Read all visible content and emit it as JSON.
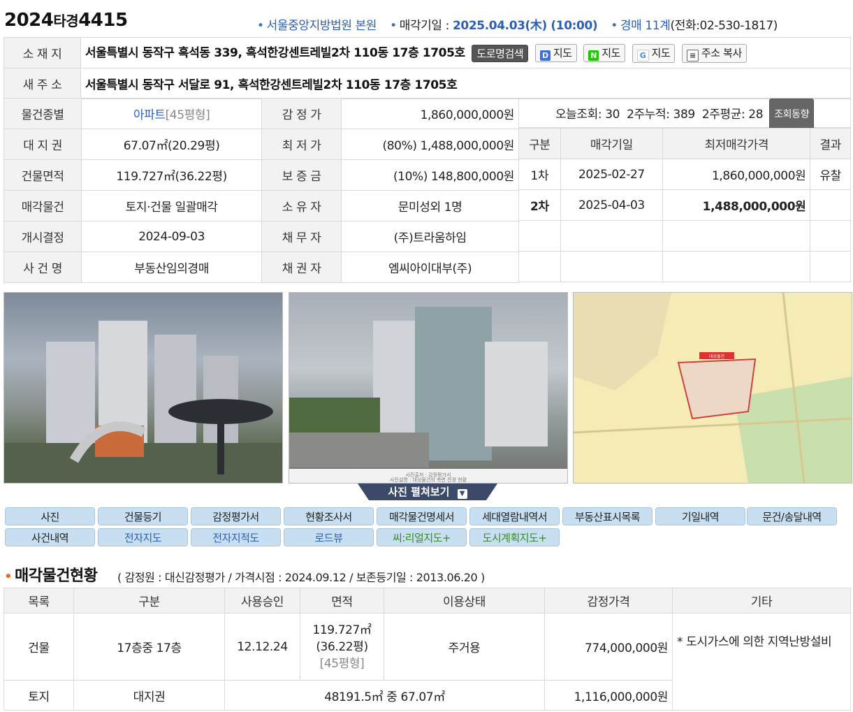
{
  "header": {
    "case_year": "2024",
    "case_type": "타경",
    "case_number": "4415",
    "court": "서울중앙지방법원 본원",
    "sale_date_label": "매각기일 : ",
    "sale_date": "2025.04.03(木) (10:00)",
    "dept": "경매 11계",
    "phone": "(전화:02-530-1817)"
  },
  "address": {
    "location_label": "소 재 지",
    "location_value": "서울특별시 동작구 흑석동 339, 흑석한강센트레빌2차 110동 17층 1705호",
    "road_search_btn": "도로명검색",
    "map_daum": "지도",
    "map_naver": "지도",
    "map_google": "지도",
    "copy_btn": "주소 복사",
    "new_label": "새 주 소",
    "new_value": "서울특별시 동작구 서달로 91, 흑석한강센트레빌2차 110동 17층 1705호"
  },
  "info": {
    "type_label": "물건종별",
    "type_value": "아파트",
    "type_extra": "[45평형]",
    "appraisal_label": "감 정 가",
    "appraisal_value": "1,860,000,000원",
    "land_label": "대 지 권",
    "land_value": "67.07㎡(20.29평)",
    "minimum_label": "최 저 가",
    "minimum_value": "(80%) 1,488,000,000원",
    "building_label": "건물면적",
    "building_value": "119.727㎡(36.22평)",
    "deposit_label": "보 증 금",
    "deposit_value": "(10%) 148,800,000원",
    "object_label": "매각물건",
    "object_value": "토지·건물 일괄매각",
    "owner_label": "소 유 자",
    "owner_value": "문미성외 1명",
    "start_label": "개시결정",
    "start_value": "2024-09-03",
    "debtor_label": "채 무 자",
    "debtor_value": "(주)트라움하임",
    "case_label": "사 건 명",
    "case_value": "부동산임의경매",
    "creditor_label": "채 권 자",
    "creditor_value": "엠씨아이대부(주)"
  },
  "stats": {
    "today": "오늘조회: 30",
    "two_week_total": "2주누적: 389",
    "two_week_avg": "2주평균: 28",
    "trend_btn": "조회동향"
  },
  "rounds": {
    "headers": [
      "구분",
      "매각기일",
      "최저매각가격",
      "결과"
    ],
    "rows": [
      {
        "round": "1차",
        "date": "2025-02-27",
        "price": "1,860,000,000원",
        "result": "유찰"
      },
      {
        "round": "2차",
        "date": "2025-04-03",
        "price": "1,488,000,000원",
        "result": ""
      }
    ]
  },
  "photos": {
    "toggle": "사진 펼쳐보기",
    "caption_lines": [
      "사진출처 : 감정평가서",
      "사진설명 : 대상물건의 측면 전경 현황"
    ],
    "map_marker": "대상물건"
  },
  "nav": {
    "row1": [
      "사진",
      "건물등기",
      "감정평가서",
      "현황조사서",
      "매각물건명세서",
      "세대열람내역서",
      "부동산표시목록",
      "기일내역",
      "문건/송달내역"
    ],
    "row2": [
      "사건내역",
      "전자지도",
      "전자지적도",
      "로드뷰",
      "씨:리얼지도+",
      "도시계획지도+"
    ]
  },
  "section": {
    "title": "매각물건현황",
    "subtitle": "( 감정원 : 대신감정평가 / 가격시점 : 2024.09.12 / 보존등기일 : 2013.06.20 )"
  },
  "goods": {
    "headers": [
      "목록",
      "구분",
      "사용승인",
      "면적",
      "이용상태",
      "감정가격",
      "기타"
    ],
    "building": {
      "item": "건물",
      "kind": "17층중 17층",
      "approved": "12.12.24",
      "area1": "119.727㎡",
      "area2": "(36.22평)",
      "area3": "[45평형]",
      "use": "주거용",
      "price": "774,000,000원"
    },
    "land": {
      "item": "토지",
      "kind": "대지권",
      "area": "48191.5㎡ 중 67.07㎡",
      "price": "1,116,000,000원"
    },
    "note": "* 도시가스에 의한 지역난방설비"
  },
  "colors": {
    "accent_blue": "#2a5fb5",
    "bullet_orange": "#f07020",
    "nav_bg": "#c7dff0"
  }
}
